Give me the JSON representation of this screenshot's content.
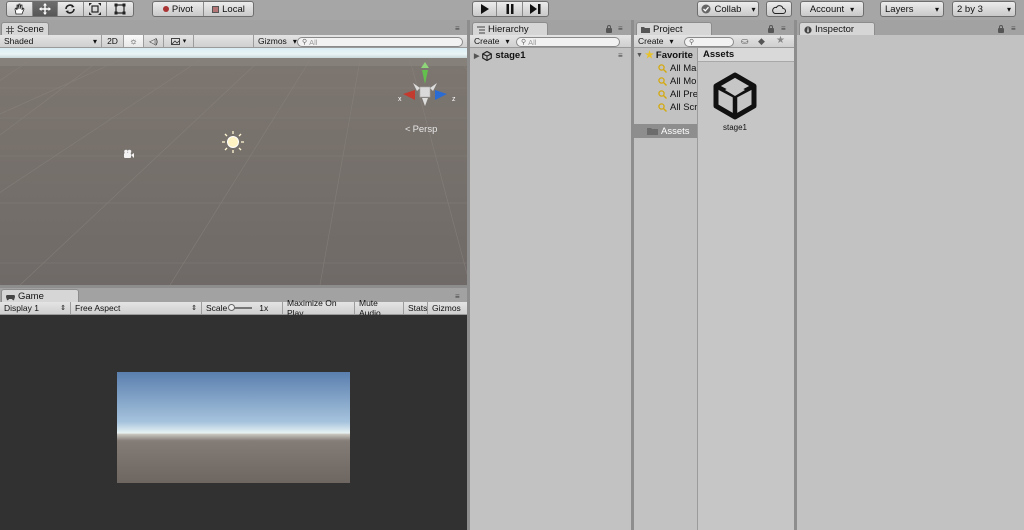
{
  "toolbar": {
    "tools": [
      "hand-icon",
      "move-icon",
      "rotate-icon",
      "scale-icon",
      "rect-icon"
    ],
    "pivot_label": "Pivot",
    "local_label": "Local",
    "collab_label": "Collab",
    "account_label": "Account",
    "layers_label": "Layers",
    "layout_label": "2 by 3"
  },
  "scene": {
    "tab_label": "Scene",
    "shading_label": "Shaded",
    "mode_2d_label": "2D",
    "gizmos_label": "Gizmos",
    "search_placeholder": "All",
    "persp_label": "Persp",
    "axis_x": "x",
    "axis_z": "z"
  },
  "game": {
    "tab_label": "Game",
    "display_label": "Display 1",
    "aspect_label": "Free Aspect",
    "scale_label": "Scale",
    "scale_value": "1x",
    "maximize_label": "Maximize On Play",
    "mute_label": "Mute Audio",
    "stats_label": "Stats",
    "gizmos_label": "Gizmos"
  },
  "hierarchy": {
    "tab_label": "Hierarchy",
    "create_label": "Create",
    "search_placeholder": "All",
    "scene_name": "stage1"
  },
  "project": {
    "tab_label": "Project",
    "create_label": "Create",
    "favorites_label": "Favorite",
    "favorites": [
      "All Ma",
      "All Mo",
      "All Pre",
      "All Scr"
    ],
    "assets_folder_label": "Assets",
    "assets_header": "Assets",
    "asset_item": "stage1"
  },
  "inspector": {
    "tab_label": "Inspector"
  }
}
